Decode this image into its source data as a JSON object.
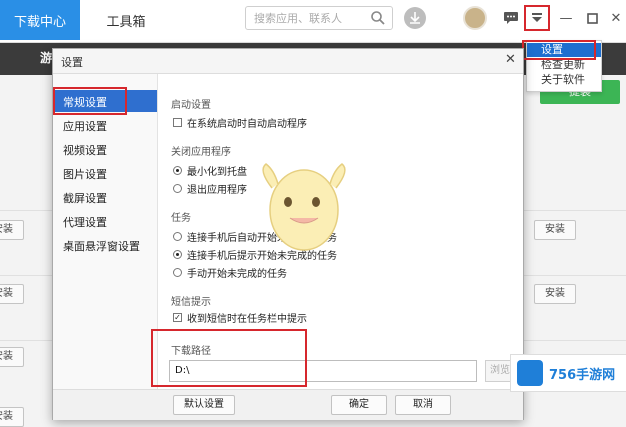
{
  "topbar": {
    "active_tab": "下载中心",
    "tools_tab": "工具箱",
    "search_placeholder": "搜索应用、联系人"
  },
  "subbar": {
    "game_tab": "游"
  },
  "green_button": "提装",
  "install_label": "安装",
  "dropdown": {
    "items": [
      {
        "label": "设置"
      },
      {
        "label": "检查更新"
      },
      {
        "label": "关于软件"
      }
    ]
  },
  "dialog": {
    "title": "设置",
    "nav": [
      {
        "label": "常规设置"
      },
      {
        "label": "应用设置"
      },
      {
        "label": "视频设置"
      },
      {
        "label": "图片设置"
      },
      {
        "label": "截屏设置"
      },
      {
        "label": "代理设置"
      },
      {
        "label": "桌面悬浮窗设置"
      }
    ],
    "startup": {
      "title": "启动设置",
      "option": "在系统启动时自动启动程序"
    },
    "close_app": {
      "title": "关闭应用程序",
      "options": [
        "最小化到托盘",
        "退出应用程序"
      ]
    },
    "tasks": {
      "title": "任务",
      "options": [
        "连接手机后自动开始未完成的任务",
        "连接手机后提示开始未完成的任务",
        "手动开始未完成的任务"
      ]
    },
    "sms": {
      "title": "短信提示",
      "option": "收到短信时在任务栏中提示"
    },
    "download_path": {
      "title": "下载路径",
      "value": "D:\\",
      "browse": "浏览"
    },
    "footer": {
      "default": "默认设置",
      "ok": "确定",
      "cancel": "取消"
    }
  },
  "brand": {
    "text": "756手游网"
  }
}
